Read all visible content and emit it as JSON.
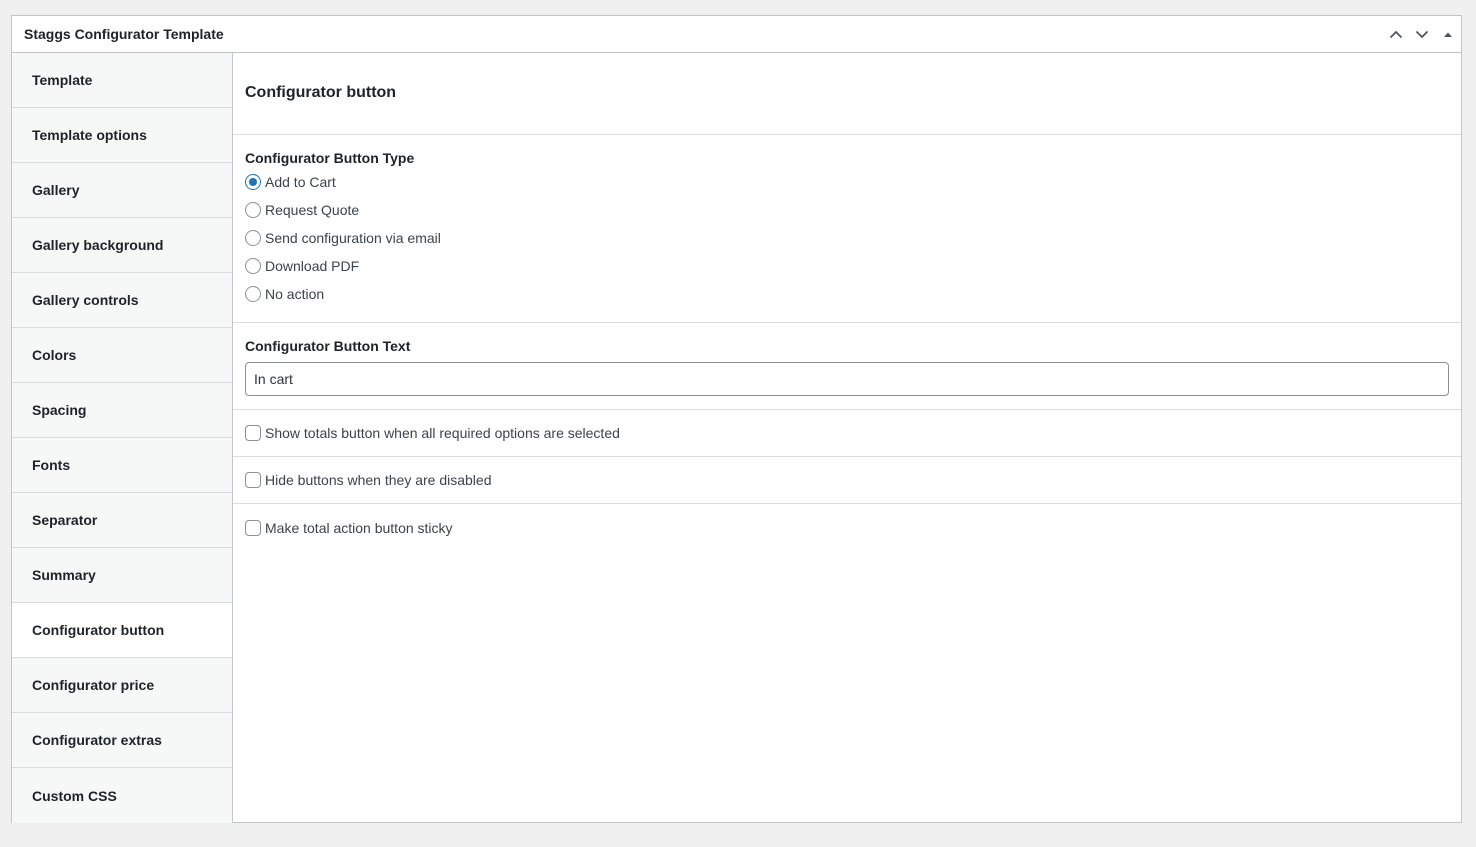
{
  "panel": {
    "title": "Staggs Configurator Template",
    "controls": {
      "move_up_icon": "chevron-up-icon",
      "move_down_icon": "chevron-down-icon",
      "toggle_icon": "triangle-up-icon"
    }
  },
  "sidebar": {
    "active_index": 10,
    "items": [
      {
        "label": "Template"
      },
      {
        "label": "Template options"
      },
      {
        "label": "Gallery"
      },
      {
        "label": "Gallery background"
      },
      {
        "label": "Gallery controls"
      },
      {
        "label": "Colors"
      },
      {
        "label": "Spacing"
      },
      {
        "label": "Fonts"
      },
      {
        "label": "Separator"
      },
      {
        "label": "Summary"
      },
      {
        "label": "Configurator button"
      },
      {
        "label": "Configurator price"
      },
      {
        "label": "Configurator extras"
      },
      {
        "label": "Custom CSS"
      }
    ]
  },
  "main": {
    "section_title": "Configurator button",
    "button_type": {
      "label": "Configurator Button Type",
      "selected_index": 0,
      "options": [
        {
          "label": "Add to Cart"
        },
        {
          "label": "Request Quote"
        },
        {
          "label": "Send configuration via email"
        },
        {
          "label": "Download PDF"
        },
        {
          "label": "No action"
        }
      ]
    },
    "button_text": {
      "label": "Configurator Button Text",
      "value": "In cart"
    },
    "checkboxes": [
      {
        "label": "Show totals button when all required options are selected",
        "checked": false
      },
      {
        "label": "Hide buttons when they are disabled",
        "checked": false
      },
      {
        "label": "Make total action button sticky",
        "checked": false
      }
    ]
  },
  "colors": {
    "accent": "#2271b1",
    "border": "#c3c4c7",
    "sidebar_bg": "#f6f7f7",
    "page_bg": "#f0f0f1"
  }
}
